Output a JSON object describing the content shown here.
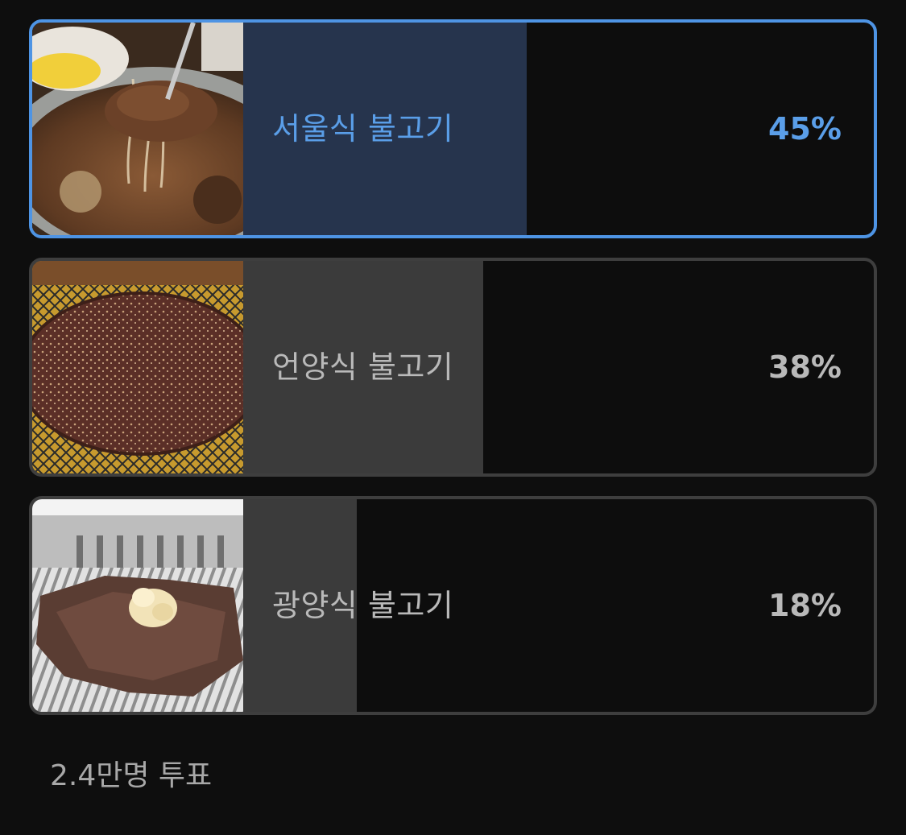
{
  "poll": {
    "options": [
      {
        "label": "서울식 불고기",
        "percent": "45%",
        "fill_fraction": 0.45,
        "selected": true,
        "image": "seoul-bulgogi-photo"
      },
      {
        "label": "언양식 불고기",
        "percent": "38%",
        "fill_fraction": 0.38,
        "selected": false,
        "image": "eonyang-bulgogi-photo"
      },
      {
        "label": "광양식 불고기",
        "percent": "18%",
        "fill_fraction": 0.18,
        "selected": false,
        "image": "gwangyang-bulgogi-photo"
      }
    ],
    "vote_count": "2.4만명 투표"
  },
  "colors": {
    "background": "#0e0e0e",
    "selected_border": "#4e94e4",
    "selected_fill": "#26344d",
    "selected_text": "#5a9ee8",
    "unselected_border": "#3e3e3e",
    "unselected_fill": "#3b3b3b",
    "unselected_text": "#b9b9b9"
  }
}
